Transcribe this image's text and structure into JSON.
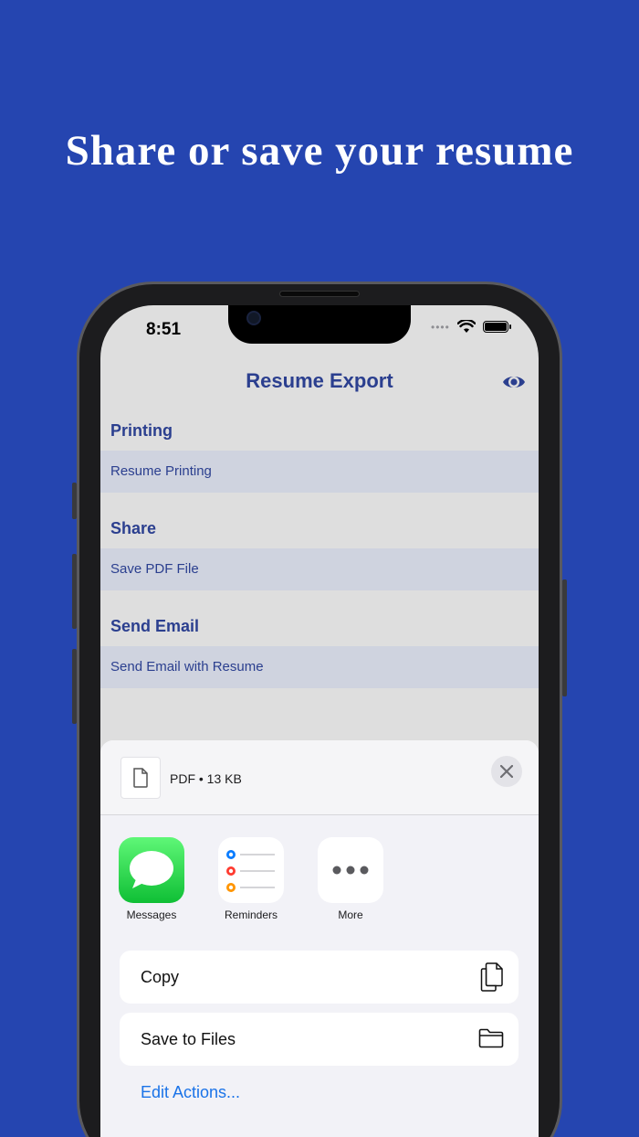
{
  "headline": "Share or save your resume",
  "status": {
    "time": "8:51"
  },
  "nav": {
    "title": "Resume Export"
  },
  "sections": [
    {
      "title": "Printing",
      "row": "Resume Printing"
    },
    {
      "title": "Share",
      "row": "Save PDF File"
    },
    {
      "title": "Send Email",
      "row": "Send Email with Resume"
    }
  ],
  "sheet": {
    "file_info": "PDF • 13 KB",
    "apps": [
      {
        "label": "Messages",
        "icon": "messages-icon"
      },
      {
        "label": "Reminders",
        "icon": "reminders-icon"
      },
      {
        "label": "More",
        "icon": "more-icon"
      }
    ],
    "actions": [
      {
        "label": "Copy",
        "icon": "copy-icon"
      },
      {
        "label": "Save to Files",
        "icon": "folder-icon"
      }
    ],
    "edit_actions": "Edit Actions..."
  },
  "colors": {
    "background": "#2545b0",
    "accent": "#2b3f8f",
    "row": "#cfd3df",
    "link": "#1a73e8",
    "messages_green": "#34c759"
  }
}
